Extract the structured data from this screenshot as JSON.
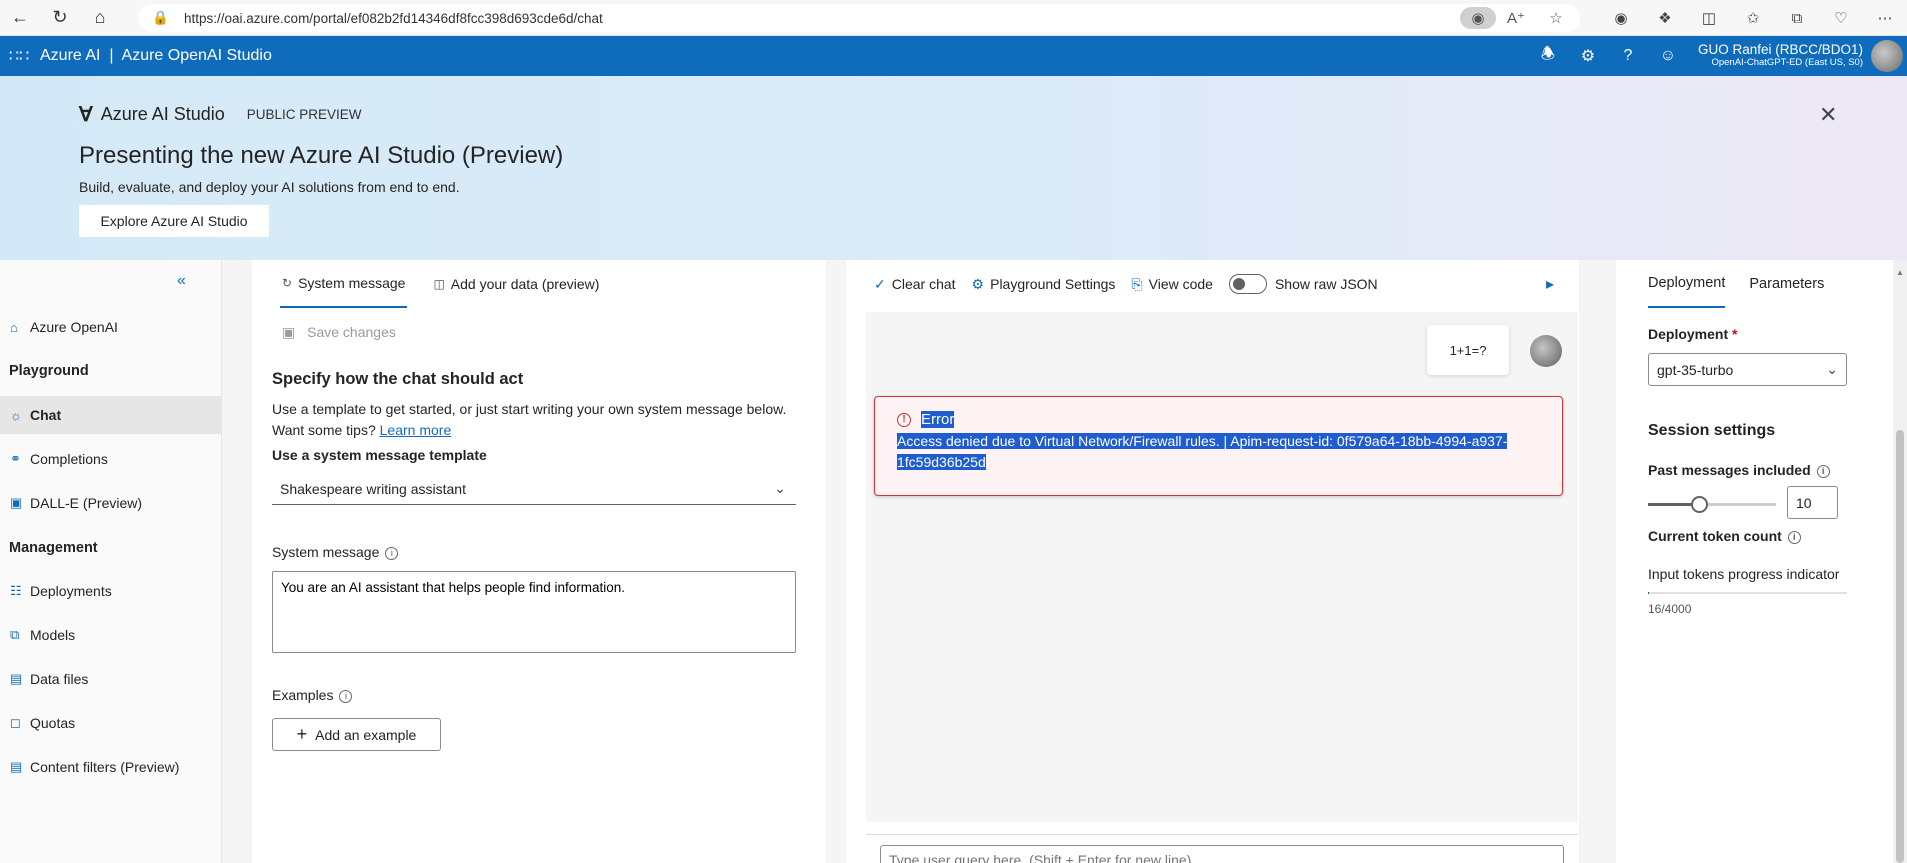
{
  "browser": {
    "url": "https://oai.azure.com/portal/ef082b2fd14346df8fcc398d693cde6d/chat"
  },
  "header": {
    "app_title": "Azure AI  |  Azure OpenAI Studio",
    "user_name": "GUO Ranfei (RBCC/BDO1)",
    "user_sub": "OpenAI-ChatGPT-ED (East US, S0)"
  },
  "banner": {
    "brand": "Azure AI Studio",
    "badge": "PUBLIC PREVIEW",
    "title": "Presenting the new Azure AI Studio (Preview)",
    "subtitle": "Build, evaluate, and deploy your AI solutions from end to end.",
    "button": "Explore Azure AI Studio"
  },
  "nav": {
    "azure_openai": "Azure OpenAI",
    "playground": "Playground",
    "chat": "Chat",
    "completions": "Completions",
    "dalle": "DALL-E (Preview)",
    "management": "Management",
    "deployments": "Deployments",
    "models": "Models",
    "data_files": "Data files",
    "quotas": "Quotas",
    "content_filters": "Content filters (Preview)"
  },
  "setup": {
    "tab_system": "System message",
    "tab_data": "Add your data (preview)",
    "save_changes": "Save changes",
    "heading": "Specify how the chat should act",
    "desc": "Use a template to get started, or just start writing your own system message below. Want some tips?",
    "learn_more": "Learn more",
    "template_label": "Use a system message template",
    "template_value": "Shakespeare writing assistant",
    "sysmsg_label": "System message",
    "sysmsg_value": "You are an AI assistant that helps people find information.",
    "examples_label": "Examples",
    "add_example": "Add an example"
  },
  "chat": {
    "clear_chat": "Clear chat",
    "playground_settings": "Playground Settings",
    "view_code": "View code",
    "show_raw_json": "Show raw JSON",
    "user_message": "1+1=?",
    "error_title": "Error",
    "error_line1": "Access denied due to Virtual Network/Firewall rules. | Apim-request-id: 0f579a64-18bb-4994-a937-",
    "error_line2": "1fc59d36b25d",
    "query_placeholder": "Type user query here. (Shift + Enter for new line)"
  },
  "config": {
    "tab_deployment": "Deployment",
    "tab_parameters": "Parameters",
    "deployment_label": "Deployment",
    "required_mark": "*",
    "deployment_value": "gpt-35-turbo",
    "session_heading": "Session settings",
    "past_messages_label": "Past messages included",
    "past_messages_value": "10",
    "past_messages_fraction": 0.4,
    "token_count_label": "Current token count",
    "progress_label": "Input tokens progress indicator",
    "token_count": "16/4000",
    "token_fraction": 0.004
  }
}
